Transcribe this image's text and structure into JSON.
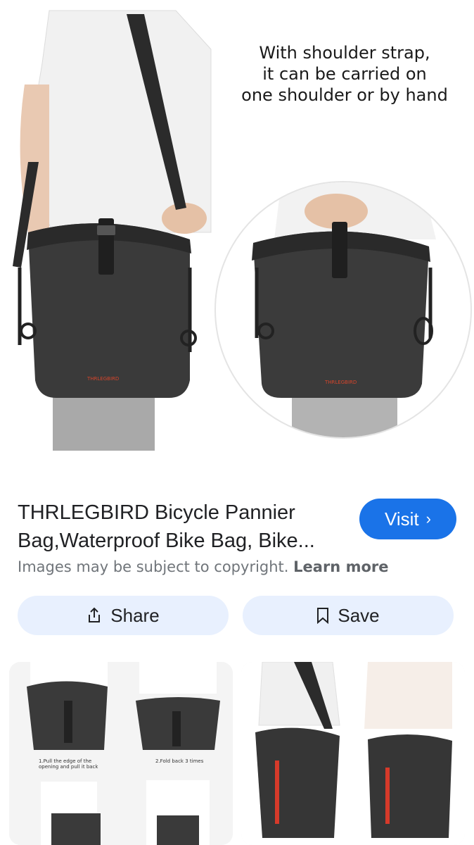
{
  "hero": {
    "caption_lines": [
      "With shoulder strap,",
      "it can be carried on",
      "one shoulder or by hand"
    ],
    "brand_mark": "THRLEGBIRD"
  },
  "result": {
    "title_line1": "THRLEGBIRD Bicycle Pannier",
    "title_line2": "Bag,Waterproof Bike Bag, Bike...",
    "visit_label": "Visit",
    "copyright_text": "Images may be subject to copyright.",
    "learn_more": "Learn more"
  },
  "actions": {
    "share_label": "Share",
    "save_label": "Save"
  },
  "related": {
    "step1": "1.Pull the edge of the opening and pull it back",
    "step2": "2.Fold back 3 times"
  },
  "colors": {
    "accent": "#1a73e8",
    "pill_bg": "#e8f0fe",
    "brand_red": "#d6452b"
  }
}
